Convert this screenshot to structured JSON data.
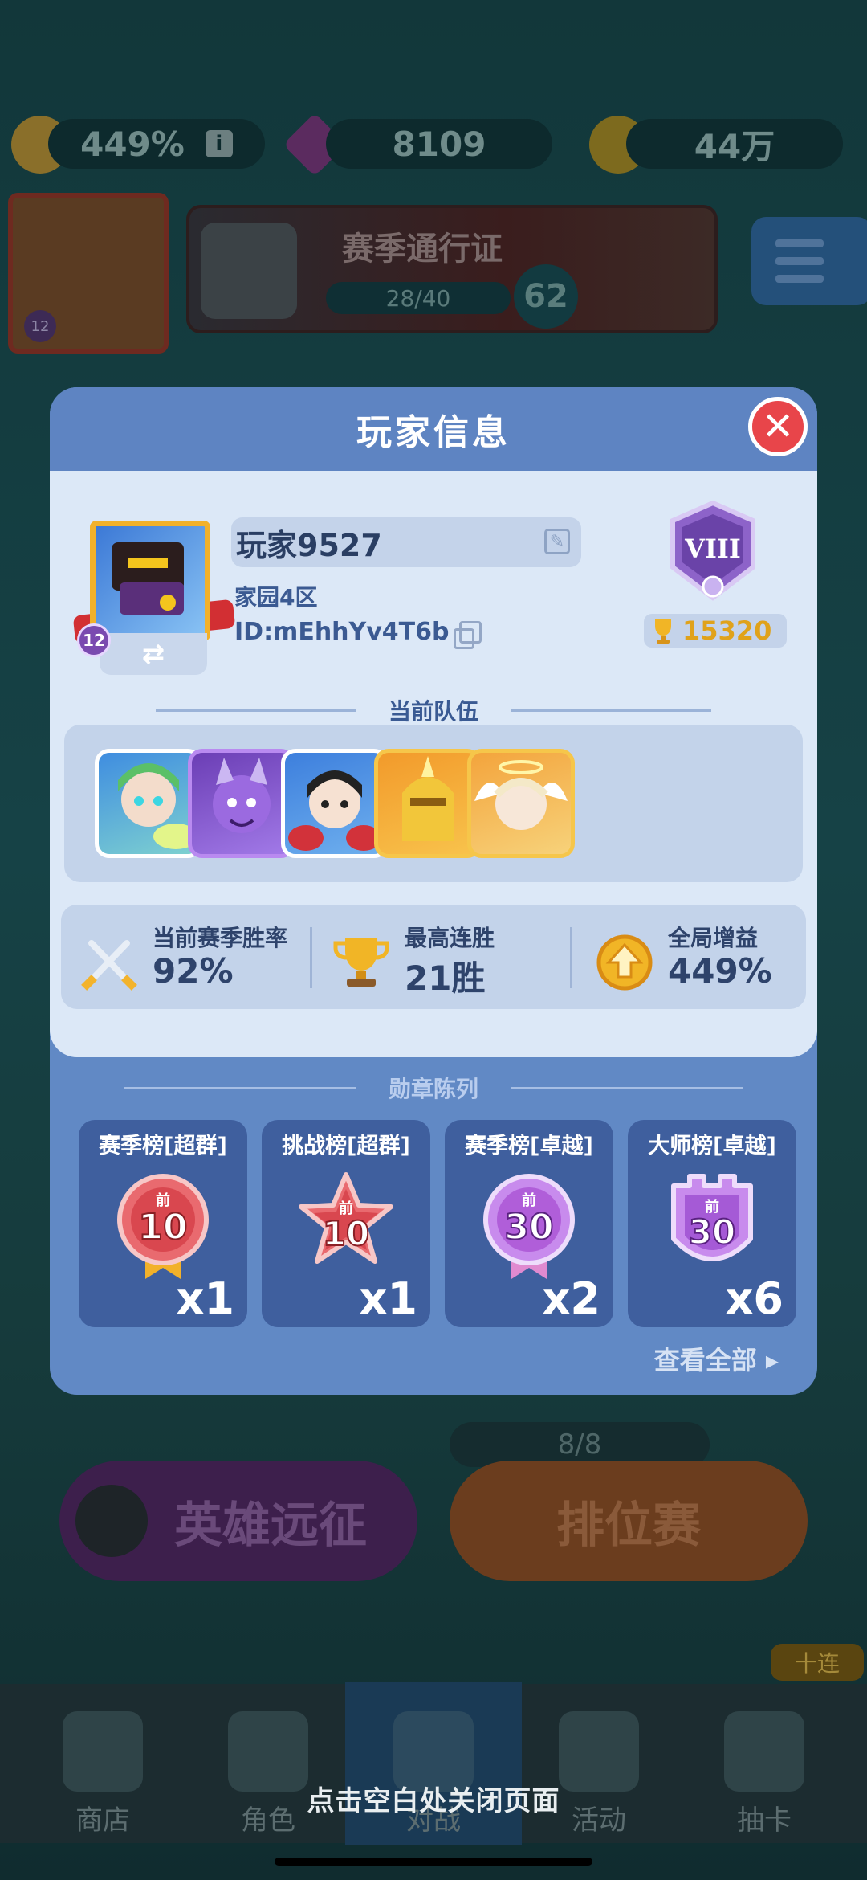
{
  "background": {
    "resources": {
      "boost": "449%",
      "gems": "8109",
      "coins": "44万"
    },
    "player_level": "12",
    "season_pass": {
      "title": "赛季通行证",
      "progress": "28/40",
      "level": "62"
    },
    "buttons": {
      "expedition": "英雄远征",
      "ranked": "排位赛",
      "ranked_tickets": "8/8",
      "ten_pull": "十连"
    },
    "tabs": [
      "商店",
      "角色",
      "对战",
      "活动",
      "抽卡"
    ]
  },
  "modal": {
    "title": "玩家信息",
    "close_icon": "close-icon",
    "player": {
      "name": "玩家9527",
      "server": "家园4区",
      "id": "ID:mEhhYv4T6b",
      "level": "12",
      "rank_numeral": "VIII",
      "trophies": "15320"
    },
    "team": {
      "title": "当前队伍",
      "heroes": [
        "green-elf-hero",
        "purple-demon-hero",
        "red-ninja-hero",
        "golden-knight-hero",
        "angel-hero"
      ]
    },
    "stats": [
      {
        "label": "当前赛季胜率",
        "value": "92%",
        "icon": "crossed-swords-icon"
      },
      {
        "label": "最高连胜",
        "value": "21胜",
        "icon": "trophy-icon"
      },
      {
        "label": "全局增益",
        "value": "449%",
        "icon": "boost-arrow-icon"
      }
    ],
    "medals": {
      "title": "勋章陈列",
      "items": [
        {
          "name": "赛季榜[超群]",
          "rank_prefix": "前",
          "rank": "10",
          "count": "x1",
          "color": "#d9474f",
          "shape": "circle"
        },
        {
          "name": "挑战榜[超群]",
          "rank_prefix": "前",
          "rank": "10",
          "count": "x1",
          "color": "#d9474f",
          "shape": "star"
        },
        {
          "name": "赛季榜[卓越]",
          "rank_prefix": "前",
          "rank": "30",
          "count": "x2",
          "color": "#b05ed9",
          "shape": "circle"
        },
        {
          "name": "大师榜[卓越]",
          "rank_prefix": "前",
          "rank": "30",
          "count": "x6",
          "color": "#a55ad6",
          "shape": "shield"
        }
      ],
      "view_all": "查看全部 ▸"
    }
  },
  "close_hint": "点击空白处关闭页面"
}
